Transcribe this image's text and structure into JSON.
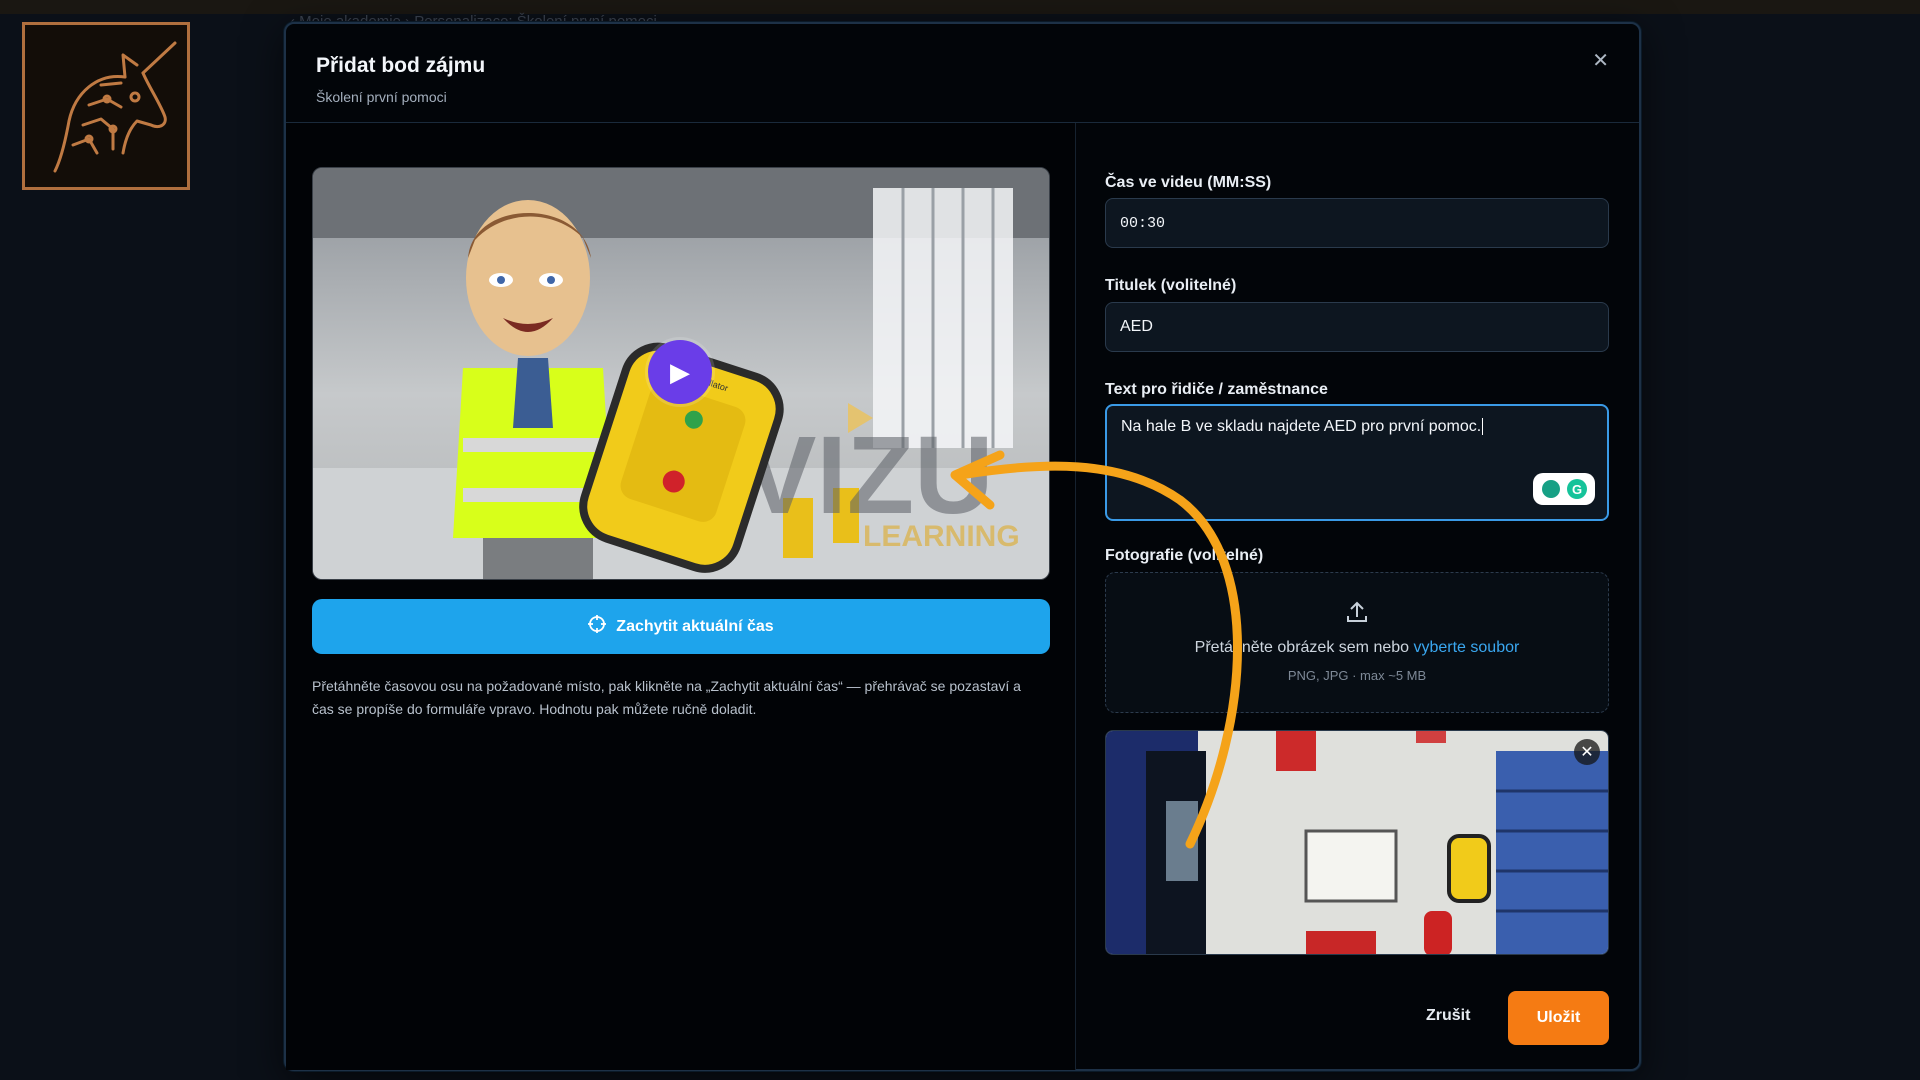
{
  "breadcrumb": "‹ Moje akademie  ›  Personalizace: Školení první pomoci",
  "modal": {
    "title": "Přidat bod zájmu",
    "subtitle": "Školení první pomoci",
    "close_icon": "close-icon"
  },
  "video": {
    "watermark": "VIZU",
    "watermark_sub": "LEARNING",
    "device_label": "Defibrillator"
  },
  "capture": {
    "button_label": "Zachytit aktuální čas",
    "icon": "crosshair-icon",
    "help_text": "Přetáhněte časovou osu na požadované místo, pak klikněte na „Zachytit aktuální čas“ — přehrávač se pozastaví a čas se propíše do formuláře vpravo. Hodnotu pak můžete ručně doladit."
  },
  "form": {
    "time_label": "Čas ve videu (MM:SS)",
    "time_value": "00:30",
    "title_label": "Titulek (volitelné)",
    "title_value": "AED",
    "text_label": "Text pro řidiče / zaměstnance",
    "text_value": "Na hale B ve skladu najdete AED pro první pomoc.",
    "photo_label": "Fotografie (volitelné)"
  },
  "dropzone": {
    "text": "Přetáhněte obrázek sem nebo ",
    "link": "vyberte soubor",
    "hint": "PNG, JPG · max ~5 MB"
  },
  "actions": {
    "cancel": "Zrušit",
    "save": "Uložit"
  },
  "colors": {
    "accent_blue": "#1ea4ec",
    "save_orange": "#f57b13",
    "arrow_orange": "#f5a319",
    "play_purple": "#6a3de8"
  }
}
